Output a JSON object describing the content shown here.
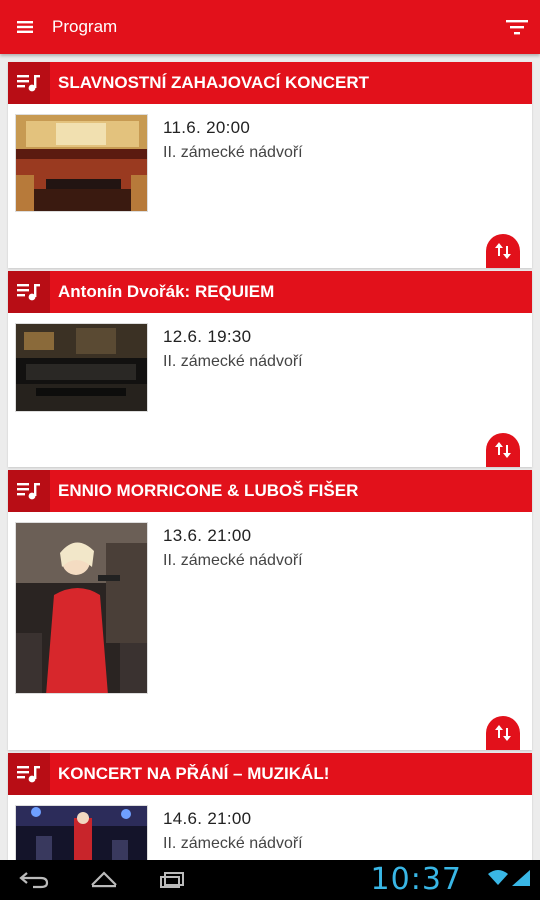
{
  "header": {
    "title": "Program"
  },
  "events": [
    {
      "title": "SLAVNOSTNÍ ZAHAJOVACÍ KONCERT",
      "datetime": "11.6. 20:00",
      "venue": "II. zámecké nádvoří"
    },
    {
      "title": "Antonín Dvořák: REQUIEM",
      "datetime": "12.6. 19:30",
      "venue": "II. zámecké nádvoří"
    },
    {
      "title": "ENNIO MORRICONE & LUBOŠ FIŠER",
      "datetime": "13.6. 21:00",
      "venue": "II. zámecké nádvoří"
    },
    {
      "title": "KONCERT NA PŘÁNÍ – MUZIKÁL!",
      "datetime": "14.6. 21:00",
      "venue": "II. zámecké nádvoří"
    }
  ],
  "system": {
    "time": "10:37"
  },
  "colors": {
    "accent": "#e2111b",
    "accent_dark": "#b80d15",
    "clock": "#39b7e6"
  },
  "icons": [
    "menu-icon",
    "filter-icon",
    "playlist-icon",
    "sort-icon",
    "back-icon",
    "home-icon",
    "recent-apps-icon",
    "wifi-icon",
    "signal-icon"
  ]
}
